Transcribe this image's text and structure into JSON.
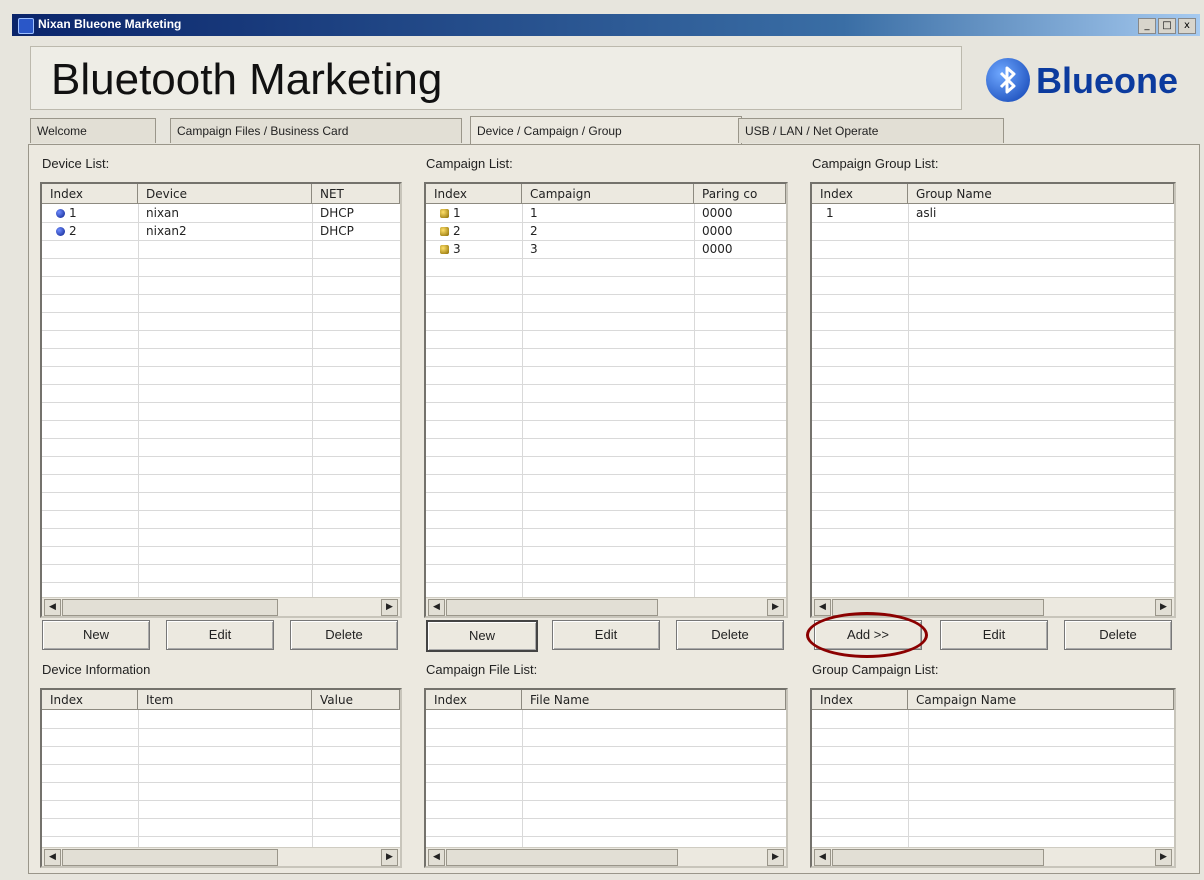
{
  "window": {
    "title": "Nixan Blueone Marketing",
    "controls": [
      "_",
      "□",
      "x"
    ]
  },
  "banner": {
    "heading": "Bluetooth Marketing",
    "logo_text": "Blueone"
  },
  "tabs": [
    {
      "label": "Welcome"
    },
    {
      "label": "Campaign Files / Business Card"
    },
    {
      "label": "Device / Campaign / Group",
      "active": true
    },
    {
      "label": "USB / LAN / Net Operate"
    }
  ],
  "device_list": {
    "label": "Device List:",
    "columns": [
      "Index",
      "Device",
      "NET"
    ],
    "rows": [
      {
        "index": "1",
        "device": "nixan",
        "net": "DHCP"
      },
      {
        "index": "2",
        "device": "nixan2",
        "net": "DHCP"
      }
    ],
    "buttons": {
      "new": "New",
      "edit": "Edit",
      "delete": "Delete"
    }
  },
  "campaign_list": {
    "label": "Campaign List:",
    "columns": [
      "Index",
      "Campaign",
      "Paring co"
    ],
    "rows": [
      {
        "index": "1",
        "campaign": "1",
        "code": "0000"
      },
      {
        "index": "2",
        "campaign": "2",
        "code": "0000"
      },
      {
        "index": "3",
        "campaign": "3",
        "code": "0000"
      }
    ],
    "buttons": {
      "new": "New",
      "edit": "Edit",
      "delete": "Delete"
    }
  },
  "group_list": {
    "label": "Campaign Group List:",
    "columns": [
      "Index",
      "Group Name"
    ],
    "rows": [
      {
        "index": "1",
        "name": "asli"
      }
    ],
    "buttons": {
      "add": "Add >>",
      "edit": "Edit",
      "delete": "Delete"
    }
  },
  "device_info": {
    "label": "Device Information",
    "columns": [
      "Index",
      "Item",
      "Value"
    ]
  },
  "campaign_files": {
    "label": "Campaign File List:",
    "columns": [
      "Index",
      "File Name"
    ]
  },
  "group_campaigns": {
    "label": "Group Campaign List:",
    "columns": [
      "Index",
      "Campaign Name"
    ]
  },
  "colors": {
    "title_bar": "#0a246a",
    "logo_blue": "#0c3b9e",
    "highlight_circle": "#8b0000"
  }
}
